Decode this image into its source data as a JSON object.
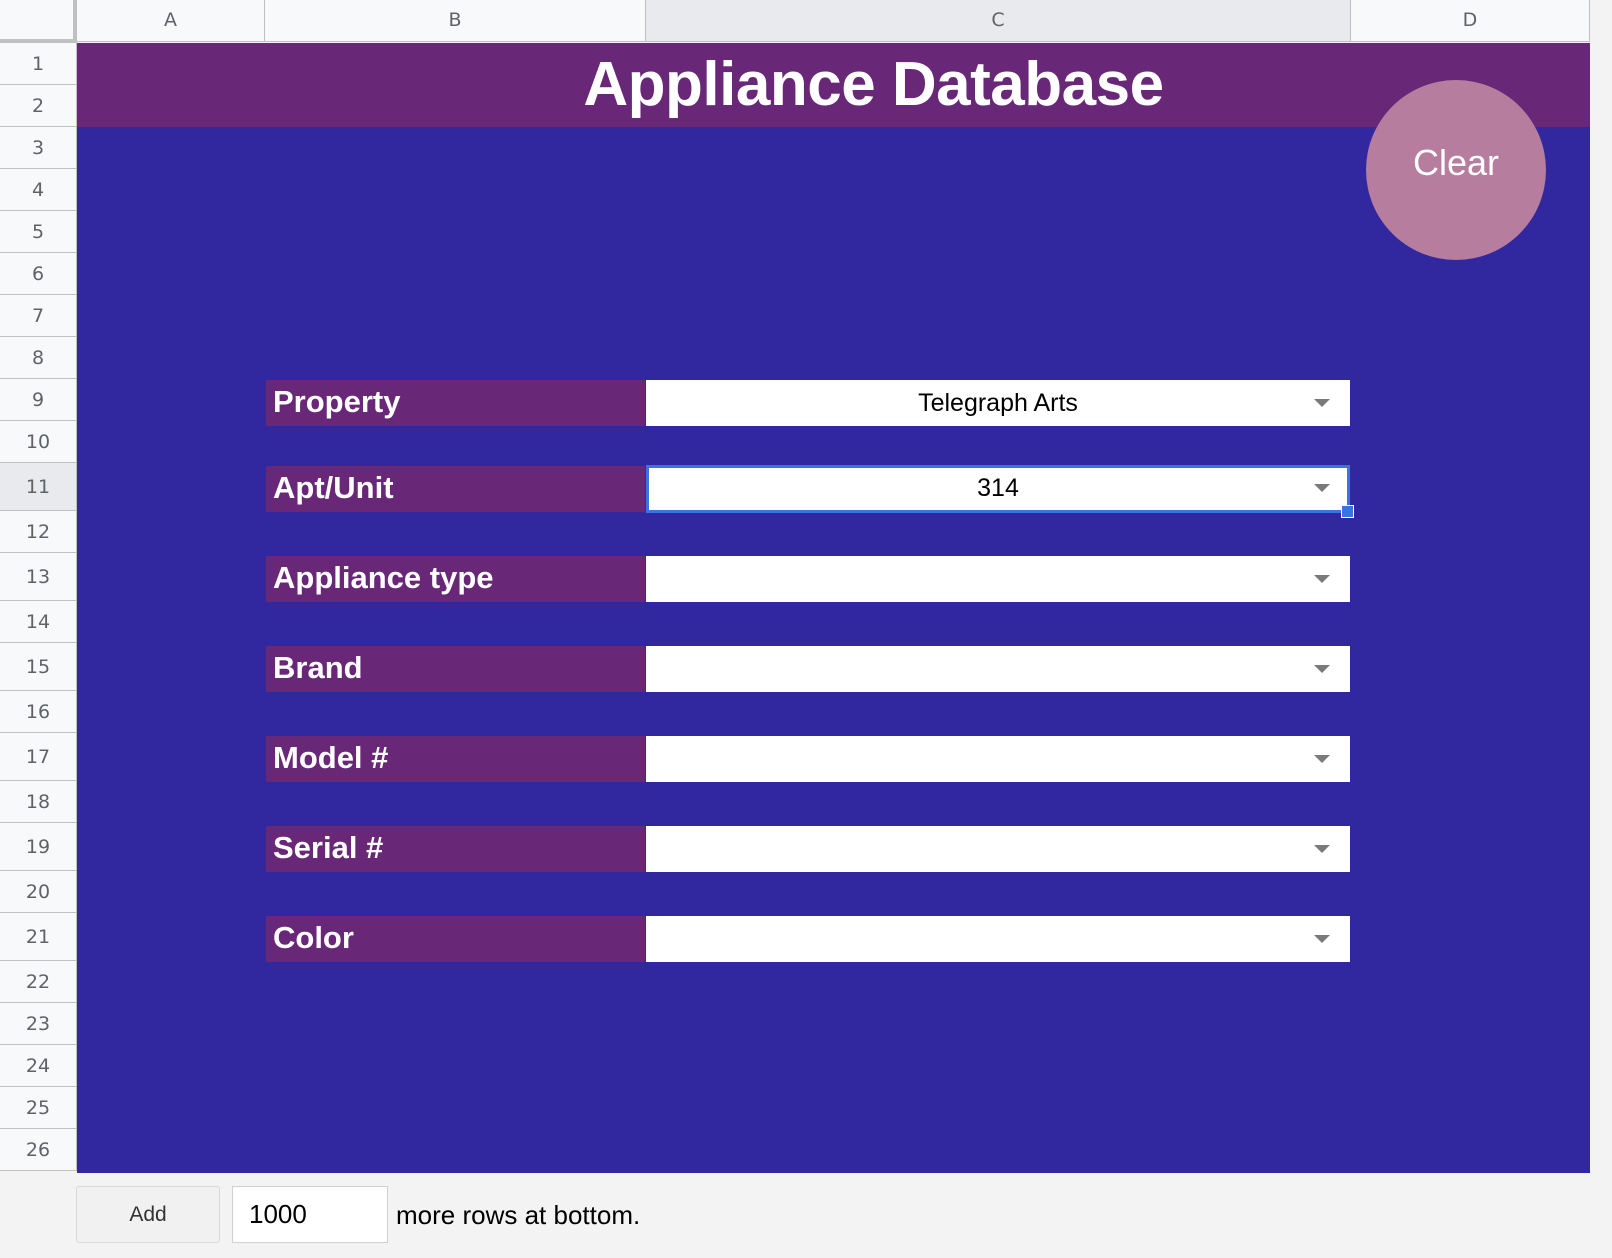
{
  "columns": [
    {
      "label": "A",
      "selected": false
    },
    {
      "label": "B",
      "selected": false
    },
    {
      "label": "C",
      "selected": true
    },
    {
      "label": "D",
      "selected": false
    }
  ],
  "rows": [
    "1",
    "2",
    "3",
    "4",
    "5",
    "6",
    "7",
    "8",
    "9",
    "10",
    "11",
    "12",
    "13",
    "14",
    "15",
    "16",
    "17",
    "18",
    "19",
    "20",
    "21",
    "22",
    "23",
    "24",
    "25",
    "26"
  ],
  "selected_row": "11",
  "sheet": {
    "title": "Appliance Database",
    "clear_button": "Clear",
    "form": [
      {
        "label": "Property",
        "value": "Telegraph Arts"
      },
      {
        "label": "Apt/Unit",
        "value": "314"
      },
      {
        "label": "Appliance type",
        "value": ""
      },
      {
        "label": "Brand",
        "value": ""
      },
      {
        "label": "Model #",
        "value": ""
      },
      {
        "label": "Serial #",
        "value": ""
      },
      {
        "label": "Color",
        "value": ""
      }
    ]
  },
  "footer": {
    "add_button": "Add",
    "rows_value": "1000",
    "rows_text": "more rows at bottom."
  },
  "colors": {
    "header_purple": "#692778",
    "background_blue": "#31279f",
    "clear_button": "#b67d9e",
    "selection_blue": "#3b74e0"
  }
}
